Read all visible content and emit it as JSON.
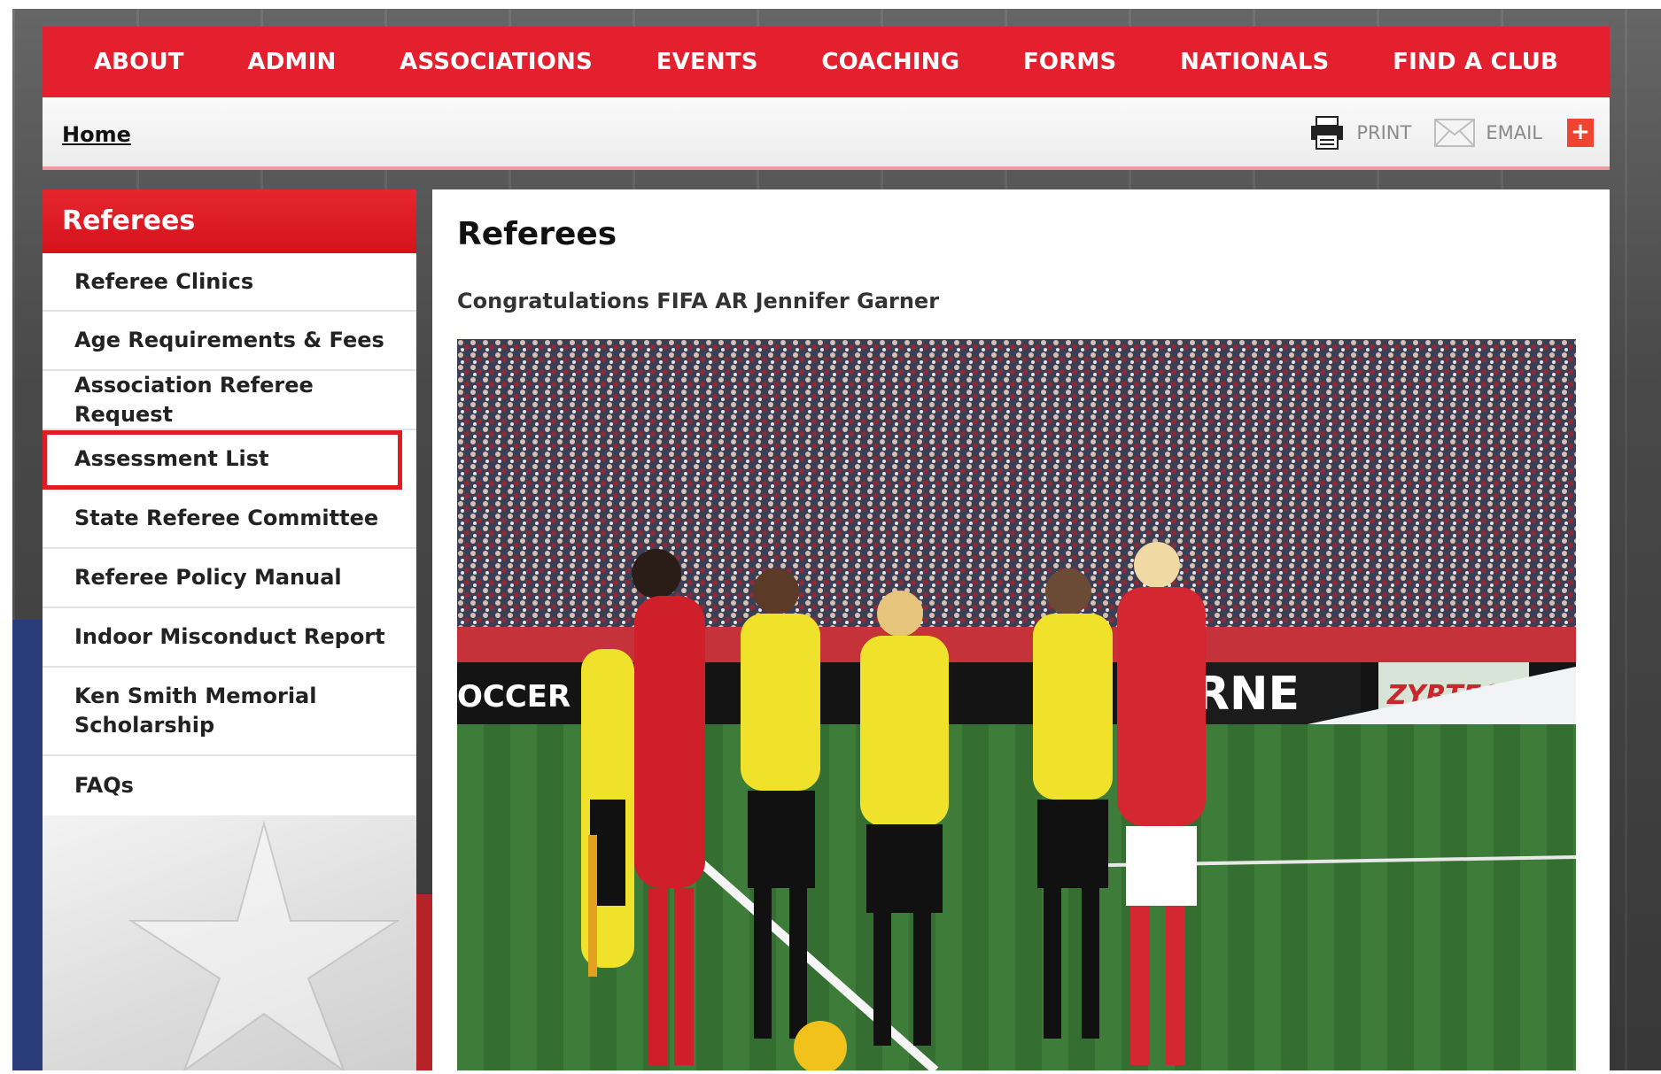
{
  "nav": {
    "items": [
      "ABOUT",
      "ADMIN",
      "ASSOCIATIONS",
      "EVENTS",
      "COACHING",
      "FORMS",
      "NATIONALS",
      "FIND A CLUB"
    ]
  },
  "breadcrumb": {
    "home": "Home"
  },
  "tools": {
    "print": "PRINT",
    "email": "EMAIL",
    "share": "+"
  },
  "sidebar": {
    "title": "Referees",
    "items": [
      {
        "label": "Referee Clinics"
      },
      {
        "label": "Age Requirements & Fees"
      },
      {
        "label": "Association Referee Request"
      },
      {
        "label": "Assessment List"
      },
      {
        "label": "State Referee Committee"
      },
      {
        "label": "Referee Policy Manual"
      },
      {
        "label": "Indoor Misconduct Report"
      },
      {
        "label": "Ken Smith Memorial Scholarship"
      },
      {
        "label": "FAQs"
      }
    ],
    "highlighted_index": 3
  },
  "main": {
    "title": "Referees",
    "subtitle": "Congratulations FIFA AR Jennifer Garner",
    "photo_alt": "Referees and team captains on soccer pitch before match",
    "banner_texts": [
      "OCCER",
      "RNE",
      "ZYRTEC"
    ]
  },
  "colors": {
    "brand_red": "#e4202e",
    "highlight_red": "#e31b23",
    "share_orange": "#ee4532"
  }
}
